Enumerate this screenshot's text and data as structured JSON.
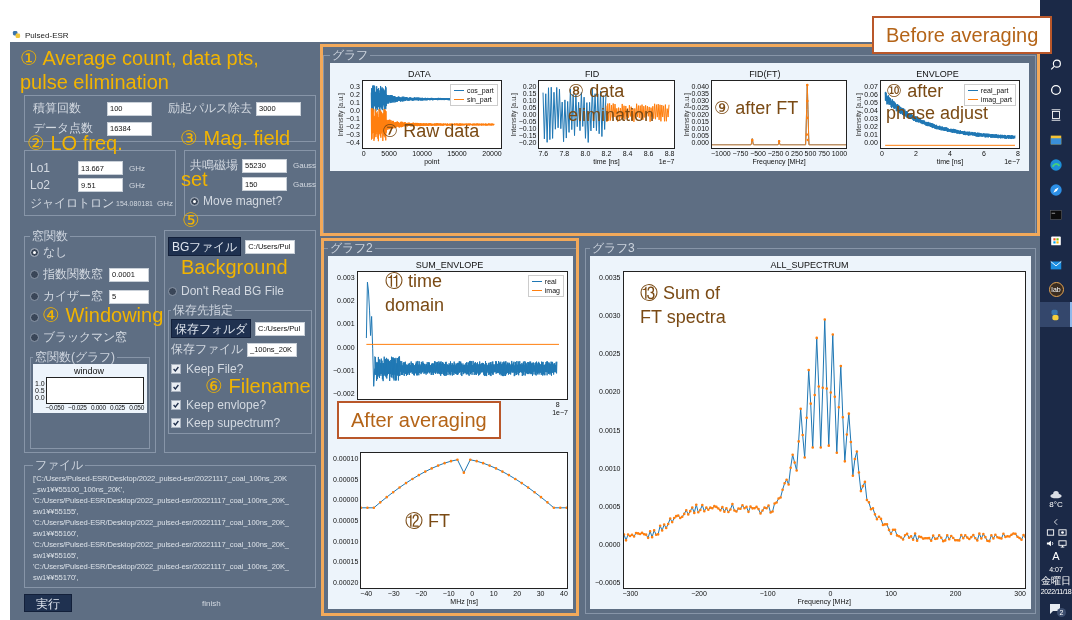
{
  "window": {
    "title": "Pulsed-ESR"
  },
  "input_group": {
    "rows": [
      {
        "label": "積算回数",
        "value": "100"
      },
      {
        "label": "データ点数",
        "value": "16384"
      }
    ],
    "pulse": {
      "label": "励起パルス除去",
      "value": "3000"
    }
  },
  "lo_group": {
    "rows": [
      {
        "label": "Lo1",
        "value": "13.667",
        "unit": "GHz"
      },
      {
        "label": "Lo2",
        "value": "9.51",
        "unit": "GHz"
      }
    ],
    "gyrotron": {
      "label": "ジャイロトロン",
      "value": "154.080181",
      "unit": "GHz"
    }
  },
  "field_group": {
    "rows": [
      {
        "label": "共鳴磁場",
        "value": "55230",
        "unit": "Gauss"
      },
      {
        "value": "150",
        "unit": "Gauss"
      }
    ],
    "move_magnet": {
      "label": "Move magnet?",
      "selected": true
    }
  },
  "window_group": {
    "title": "窓関数",
    "options": [
      {
        "label": "なし",
        "selected": true
      },
      {
        "label": "指数関数窓",
        "selected": false,
        "value": "0.0001"
      },
      {
        "label": "カイザー窓",
        "selected": false,
        "value": "5"
      },
      {
        "selected": false
      },
      {
        "label": "ブラックマン窓",
        "selected": false
      }
    ],
    "graph": {
      "title": "窓関数(グラフ)",
      "plot": {
        "title": "window",
        "yticks": [
          "1.0",
          "0.5",
          "0.0"
        ],
        "xticks": [
          "−0.050",
          "−0.025",
          "0.000",
          "0.025",
          "0.050"
        ]
      }
    }
  },
  "file_group": {
    "bg_button": "BGファイル",
    "bg_path": "C:/Users/Pul",
    "dont_read": {
      "label": "Don't Read BG File",
      "selected": false
    },
    "save": {
      "title": "保存先指定",
      "folder_button": "保存フォルダ",
      "folder_path": "C:/Users/Pul",
      "file_label": "保存ファイル",
      "file_value": "_100ns_20K",
      "checks": [
        {
          "label": "Keep File?",
          "checked": true
        },
        {
          "checked": true
        },
        {
          "label": "Keep envlope?",
          "checked": true
        },
        {
          "label": "Keep supectrum?",
          "checked": true
        }
      ]
    }
  },
  "files": {
    "title": "ファイル",
    "lines": [
      "['C:/Users/Pulsed-ESR/Desktop/2022_pulsed-esr/20221117_coal_100ns_20K",
      "_sw1¥¥55100_100ns_20K',",
      "'C:/Users/Pulsed-ESR/Desktop/2022_pulsed-esr/20221117_coal_100ns_20K_",
      "sw1¥¥55155',",
      "'C:/Users/Pulsed-ESR/Desktop/2022_pulsed-esr/20221117_coal_100ns_20K_",
      "sw1¥¥55160',",
      "'C:/Users/Pulsed-ESR/Desktop/2022_pulsed-esr/20221117_coal_100ns_20K_",
      "sw1¥¥55165',",
      "'C:/Users/Pulsed-ESR/Desktop/2022_pulsed-esr/20221117_coal_100ns_20K_",
      "sw1¥¥55170',"
    ]
  },
  "run_button": "実行",
  "status": "finish",
  "groups": [
    {
      "title": "グラフ",
      "plots": [
        {
          "kind": "data",
          "title": "DATA",
          "ylabel": "Intensity [a.u.]",
          "yticks": [
            "0.3",
            "0.2",
            "0.1",
            "0.0",
            "−0.1",
            "−0.2",
            "−0.3",
            "−0.4"
          ],
          "xticks": [
            "0",
            "5000",
            "10000",
            "15000",
            "20000"
          ],
          "xlabel": "point",
          "legend": [
            {
              "label": "cos_part",
              "color": "#1f77b4"
            },
            {
              "label": "sin_part",
              "color": "#ff7f0e"
            }
          ]
        },
        {
          "kind": "fid",
          "title": "FID",
          "ylabel": "Intensity [a.u.]",
          "yticks": [
            "0.20",
            "0.15",
            "0.10",
            "0.05",
            "0.00",
            "−0.05",
            "−0.10",
            "−0.15",
            "−0.20"
          ],
          "xticks": [
            "7.6",
            "7.8",
            "8.0",
            "8.2",
            "8.4",
            "8.6",
            "8.8"
          ],
          "xlabel": "time [ns]",
          "exponent": "1e−7"
        },
        {
          "kind": "ft",
          "title": "FID(FT)",
          "ylabel": "Intensity [a.u.]",
          "yticks": [
            "0.040",
            "0.035",
            "0.030",
            "0.025",
            "0.020",
            "0.015",
            "0.010",
            "0.005",
            "0.000"
          ],
          "xticks": [
            "−1000",
            "−750",
            "−500",
            "−250",
            "0",
            "250",
            "500",
            "750",
            "1000"
          ],
          "xlabel": "Frequency [MHz]"
        },
        {
          "kind": "env",
          "title": "ENVLOPE",
          "ylabel": "Intensity [a.u.]",
          "yticks": [
            "0.07",
            "0.06",
            "0.05",
            "0.04",
            "0.03",
            "0.02",
            "0.01",
            "0.00"
          ],
          "xticks": [
            "0",
            "2",
            "4",
            "6",
            "8"
          ],
          "xlabel": "time [ns]",
          "exponent": "1e−7",
          "legend": [
            {
              "label": "real_part",
              "color": "#1f77b4"
            },
            {
              "label": "imag_part",
              "color": "#ff7f0e"
            }
          ]
        }
      ]
    },
    {
      "title": "グラフ2",
      "plots": [
        {
          "kind": "sum",
          "title": "SUM_ENVLOPE",
          "yticks": [
            "0.003",
            "0.002",
            "0.001",
            "0.000",
            "−0.001",
            "−0.002"
          ],
          "xticks": [
            "8"
          ],
          "exponent": "1e−7",
          "legend": [
            {
              "label": "real",
              "color": "#1f77b4"
            },
            {
              "label": "imag",
              "color": "#ff7f0e"
            }
          ]
        },
        {
          "kind": "ftb",
          "yticks": [
            "0.00010",
            "0.00005",
            "0.00000",
            "0.00005",
            "0.00010",
            "0.00015",
            "0.00020"
          ],
          "xticks": [
            "−40",
            "−30",
            "−20",
            "−10",
            "0",
            "10",
            "20",
            "30",
            "40"
          ],
          "xlabel": "MHz [ns]"
        }
      ]
    },
    {
      "title": "グラフ3",
      "plots": [
        {
          "kind": "all",
          "title": "ALL_SUPECTRUM",
          "yticks": [
            "0.0035",
            "0.0030",
            "0.0025",
            "0.0020",
            "0.0015",
            "0.0010",
            "0.0005",
            "0.0000",
            "−0.0005"
          ],
          "xticks": [
            "−300",
            "−200",
            "−100",
            "0",
            "100",
            "200",
            "300"
          ],
          "xlabel": "Frequency [MHz]"
        }
      ]
    }
  ],
  "annotations": [
    {
      "kind": "yellow",
      "text": "① Average count, data pts,"
    },
    {
      "kind": "yellow",
      "text": "pulse elimination"
    },
    {
      "kind": "yellow",
      "text": "② LO freq."
    },
    {
      "kind": "yellow",
      "text": "③ Mag. field"
    },
    {
      "kind": "yellow",
      "text": "set"
    },
    {
      "kind": "yellow",
      "text": "⑤"
    },
    {
      "kind": "yellow",
      "text": "Background"
    },
    {
      "kind": "yellow",
      "text": "④ Windowing"
    },
    {
      "kind": "yellow",
      "text": "⑥ Filename"
    },
    {
      "kind": "brown",
      "text": "⑦ Raw data"
    },
    {
      "kind": "brown",
      "text": "⑧ data"
    },
    {
      "kind": "brown",
      "text": "elimination"
    },
    {
      "kind": "brown",
      "text": "⑨ after FT"
    },
    {
      "kind": "brown",
      "text": "⑩ after"
    },
    {
      "kind": "brown",
      "text": "phase adjust"
    },
    {
      "kind": "brown",
      "text": "⑪ time"
    },
    {
      "kind": "brown",
      "text": "domain"
    },
    {
      "kind": "brown",
      "text": "⑫ FT"
    },
    {
      "kind": "brown",
      "text": "⑬ Sum of"
    },
    {
      "kind": "brown",
      "text": "FT spectra"
    },
    {
      "kind": "boxed",
      "text": "Before averaging"
    },
    {
      "kind": "boxed",
      "text": "After averaging"
    }
  ],
  "taskbar": {
    "apps": [
      {
        "kind": "search",
        "selected": false
      },
      {
        "kind": "circle",
        "selected": false
      },
      {
        "kind": "taskview",
        "selected": false
      },
      {
        "kind": "folder",
        "selected": false
      },
      {
        "kind": "swirl",
        "selected": false
      },
      {
        "kind": "compass",
        "selected": false
      },
      {
        "kind": "terminal",
        "selected": false
      },
      {
        "kind": "store",
        "selected": false
      },
      {
        "kind": "mail",
        "selected": false
      },
      {
        "kind": "lab",
        "text": "lab",
        "selected": false
      },
      {
        "kind": "snake",
        "selected": true
      }
    ],
    "weather": "8°C",
    "ime": "A",
    "time": "4:07",
    "day": "金曜日",
    "date": "2022/11/18",
    "notifications": "2"
  }
}
